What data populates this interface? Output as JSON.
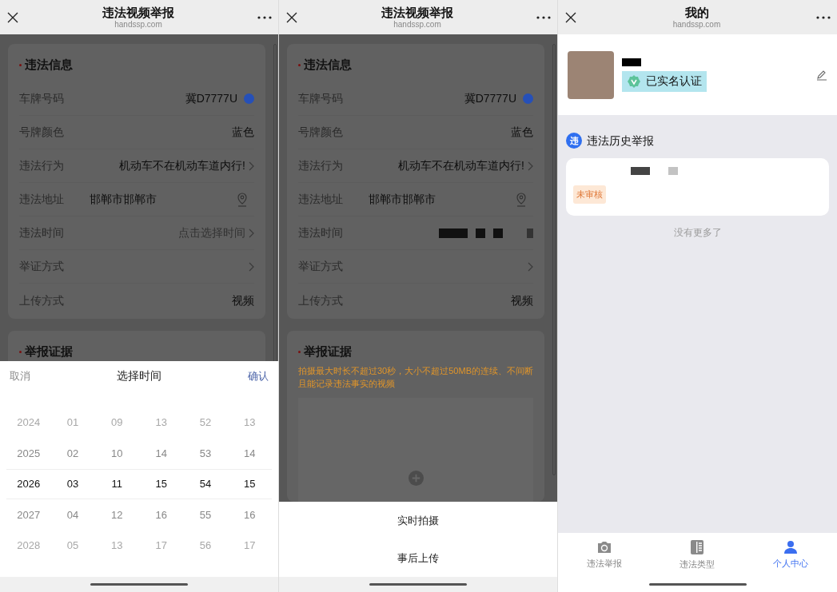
{
  "screens": [
    {
      "kind": "form",
      "header": {
        "title": "违法视频举报",
        "url": "handssp.com"
      },
      "section_title": "违法信息",
      "fields": [
        {
          "label": "车牌号码",
          "value": "冀D7777U",
          "kind": "plate",
          "color": "#2650b8"
        },
        {
          "label": "号牌颜色",
          "value": "蓝色",
          "kind": "text"
        },
        {
          "label": "违法行为",
          "value": "机动车不在机动车道内行!",
          "kind": "select"
        },
        {
          "label": "违法地址",
          "value": "邯郸市邯郸市",
          "kind": "location"
        },
        {
          "label": "违法时间",
          "placeholder": "点击选择时间",
          "kind": "select"
        },
        {
          "label": "举证方式",
          "kind": "select"
        },
        {
          "label": "上传方式",
          "value": "视频",
          "kind": "text"
        }
      ],
      "evidence": {
        "title": "举报证据"
      },
      "overlay": {
        "kind": "time_picker",
        "cancel": "取消",
        "title": "选择时间",
        "confirm": "确认",
        "rows": [
          {
            "values": [
              "2024",
              "01",
              "09",
              "13",
              "52",
              "13"
            ],
            "selected": false
          },
          {
            "values": [
              "2025",
              "02",
              "10",
              "14",
              "53",
              "14"
            ],
            "selected": false
          },
          {
            "values": [
              "2026",
              "03",
              "11",
              "15",
              "54",
              "15"
            ],
            "selected": true
          },
          {
            "values": [
              "2027",
              "04",
              "12",
              "16",
              "55",
              "16"
            ],
            "selected": false
          },
          {
            "values": [
              "2028",
              "05",
              "13",
              "17",
              "56",
              "17"
            ],
            "selected": false
          }
        ]
      }
    },
    {
      "kind": "form",
      "header": {
        "title": "违法视频举报",
        "url": "handssp.com"
      },
      "section_title": "违法信息",
      "fields": [
        {
          "label": "车牌号码",
          "value": "冀D7777U",
          "kind": "plate",
          "color": "#2650b8"
        },
        {
          "label": "号牌颜色",
          "value": "蓝色",
          "kind": "text"
        },
        {
          "label": "违法行为",
          "value": "机动车不在机动车道内行!",
          "kind": "select"
        },
        {
          "label": "违法地址",
          "value": "邯郸市邯郸市",
          "kind": "location"
        },
        {
          "label": "违法时间",
          "kind": "redacted"
        },
        {
          "label": "举证方式",
          "kind": "select"
        },
        {
          "label": "上传方式",
          "value": "视频",
          "kind": "text"
        }
      ],
      "evidence": {
        "title": "举报证据",
        "hint": "拍摄最大时长不超过30秒，大小不超过50MB的连续、不间断且能记录违法事实的视频"
      },
      "overlay": {
        "kind": "action_sheet",
        "actions": [
          "实时拍摄",
          "事后上传"
        ]
      }
    },
    {
      "kind": "profile",
      "header": {
        "title": "我的",
        "url": "handssp.com"
      },
      "verified_badge": "已实名认证",
      "history": {
        "icon_char": "违",
        "title": "违法历史举报",
        "records": [
          {
            "status": "未审核"
          }
        ],
        "end_text": "没有更多了"
      },
      "tabs": [
        {
          "label": "违法举报",
          "selected": false
        },
        {
          "label": "违法类型",
          "selected": false
        },
        {
          "label": "个人中心",
          "selected": true
        }
      ]
    }
  ]
}
